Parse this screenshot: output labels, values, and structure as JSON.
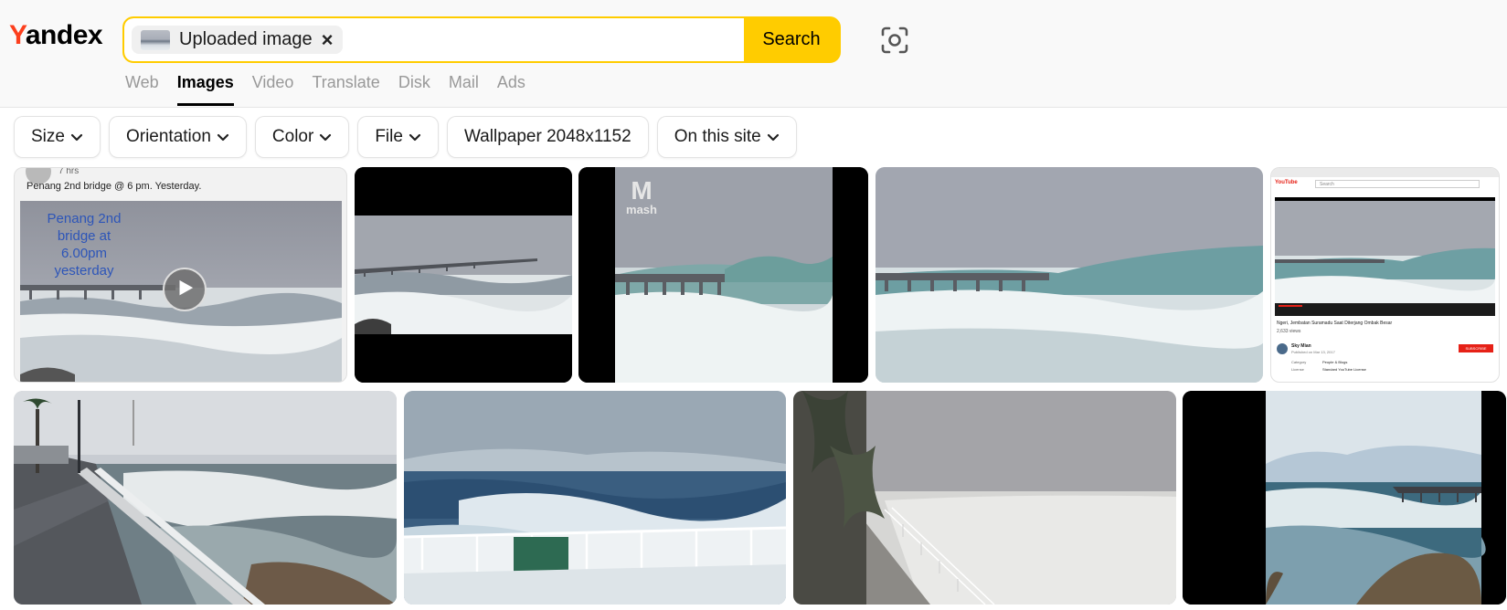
{
  "brand": {
    "logo_first": "Y",
    "logo_rest": "andex",
    "logo_color": "#fc3f1d"
  },
  "search": {
    "chip_label": "Uploaded image",
    "chip_close": "×",
    "button_label": "Search",
    "accent": "#ffcc00"
  },
  "nav": {
    "tabs": [
      {
        "label": "Web"
      },
      {
        "label": "Images",
        "active": true
      },
      {
        "label": "Video"
      },
      {
        "label": "Translate"
      },
      {
        "label": "Disk"
      },
      {
        "label": "Mail"
      },
      {
        "label": "Ads"
      }
    ]
  },
  "filters": [
    {
      "label": "Size",
      "dropdown": true
    },
    {
      "label": "Orientation",
      "dropdown": true
    },
    {
      "label": "Color",
      "dropdown": true
    },
    {
      "label": "File",
      "dropdown": true
    },
    {
      "label": "Wallpaper 2048x1152",
      "dropdown": false
    },
    {
      "label": "On this site",
      "dropdown": true
    }
  ],
  "results": {
    "tile1": {
      "time": "7 hrs",
      "caption": "Penang 2nd bridge @ 6 pm. Yesterday.",
      "overlay_lines": [
        "Penang 2nd",
        "bridge at",
        "6.00pm",
        "yesterday"
      ]
    },
    "tile3": {
      "watermark": "mash"
    },
    "tile5": {
      "video_title": "Ngeri, Jembatan Suramadu Saat Diterjang Ombak Besar",
      "views": "2,633 views",
      "channel": "Sky Mian",
      "published": "Published on Mar 13, 2017",
      "subscribe": "SUBSCRIBE",
      "category_label": "Category",
      "category_value": "People & Blogs",
      "license_label": "License",
      "license_value": "Standard YouTube License",
      "search_placeholder": "Search",
      "yt_label": "YouTube"
    }
  }
}
